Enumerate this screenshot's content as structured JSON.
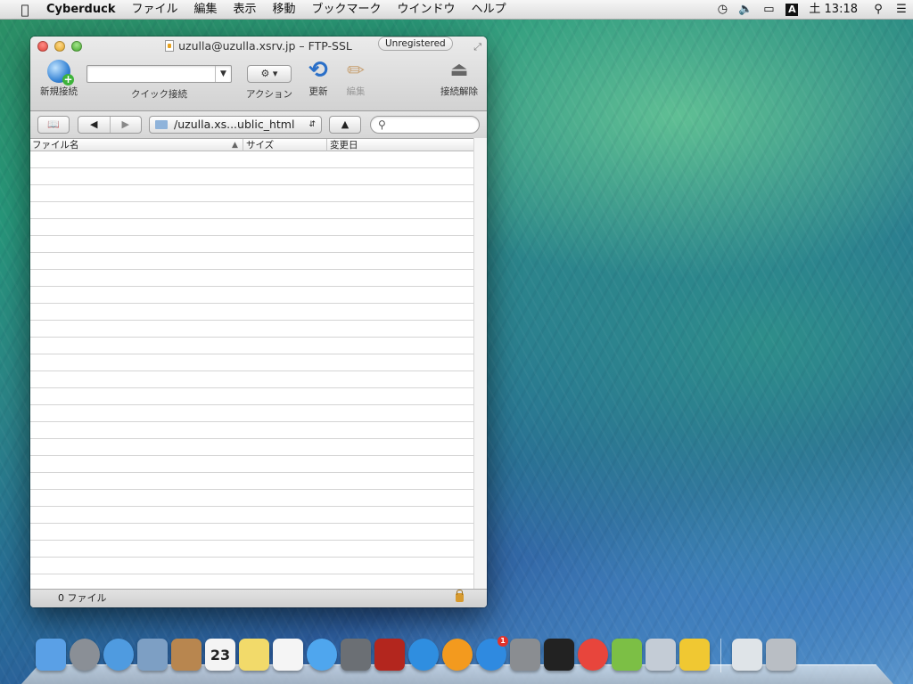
{
  "menubar": {
    "app_name": "Cyberduck",
    "menus": [
      "ファイル",
      "編集",
      "表示",
      "移動",
      "ブックマーク",
      "ウインドウ",
      "ヘルプ"
    ],
    "ime_indicator": "A",
    "clock": "土 13:18",
    "status_icons": [
      "time-machine-icon",
      "volume-icon",
      "battery-icon",
      "ime-icon",
      "spotlight-icon",
      "notification-center-icon"
    ]
  },
  "window": {
    "title": "uzulla@uzulla.xsrv.jp – FTP-SSL",
    "badge": "Unregistered",
    "toolbar": {
      "new_connection": "新規接続",
      "quick_connect": "クイック接続",
      "quick_connect_value": "",
      "action": "アクション",
      "refresh": "更新",
      "edit": "編集",
      "disconnect": "接続解除"
    },
    "navbar": {
      "path": "/uzulla.xs...ublic_html",
      "search_placeholder": ""
    },
    "columns": [
      "ファイル名",
      "サイズ",
      "変更日"
    ],
    "files": [],
    "status": "0 ファイル"
  },
  "dock": {
    "apps": [
      {
        "name": "finder",
        "icon": "finder-icon",
        "color": "#5aa0e6"
      },
      {
        "name": "launchpad",
        "icon": "launchpad-icon",
        "color": "#8a8f96"
      },
      {
        "name": "safari",
        "icon": "safari-icon",
        "color": "#4f9be0"
      },
      {
        "name": "mail",
        "icon": "mail-icon",
        "color": "#7d9fc4"
      },
      {
        "name": "contacts",
        "icon": "contacts-icon",
        "color": "#b8864f"
      },
      {
        "name": "calendar",
        "icon": "calendar-icon",
        "color": "#f4f4f4",
        "text": "23"
      },
      {
        "name": "notes",
        "icon": "notes-icon",
        "color": "#f2da6a"
      },
      {
        "name": "reminders",
        "icon": "reminders-icon",
        "color": "#f5f5f5"
      },
      {
        "name": "messages",
        "icon": "messages-icon",
        "color": "#4fa6ee"
      },
      {
        "name": "facetime",
        "icon": "facetime-icon",
        "color": "#6b6f74"
      },
      {
        "name": "photo-booth",
        "icon": "photo-booth-icon",
        "color": "#b3261e"
      },
      {
        "name": "itunes",
        "icon": "itunes-icon",
        "color": "#2f8ee0"
      },
      {
        "name": "ibooks",
        "icon": "ibooks-icon",
        "color": "#f39a1e"
      },
      {
        "name": "app-store",
        "icon": "app-store-icon",
        "color": "#2f8ae0",
        "badge": "1"
      },
      {
        "name": "system-preferences",
        "icon": "system-preferences-icon",
        "color": "#8a8d91"
      },
      {
        "name": "terminal",
        "icon": "terminal-icon",
        "color": "#222222"
      },
      {
        "name": "chrome",
        "icon": "chrome-icon",
        "color": "#e8453c"
      },
      {
        "name": "coda",
        "icon": "coda-icon",
        "color": "#7cbf45"
      },
      {
        "name": "utility",
        "icon": "utility-icon",
        "color": "#c4ccd6"
      },
      {
        "name": "cyberduck",
        "icon": "cyberduck-icon",
        "color": "#f0c832"
      }
    ],
    "right": [
      {
        "name": "documents-stack",
        "icon": "documents-stack-icon",
        "color": "#dfe4e8"
      },
      {
        "name": "trash",
        "icon": "trash-icon",
        "color": "#b9bec4"
      }
    ]
  }
}
